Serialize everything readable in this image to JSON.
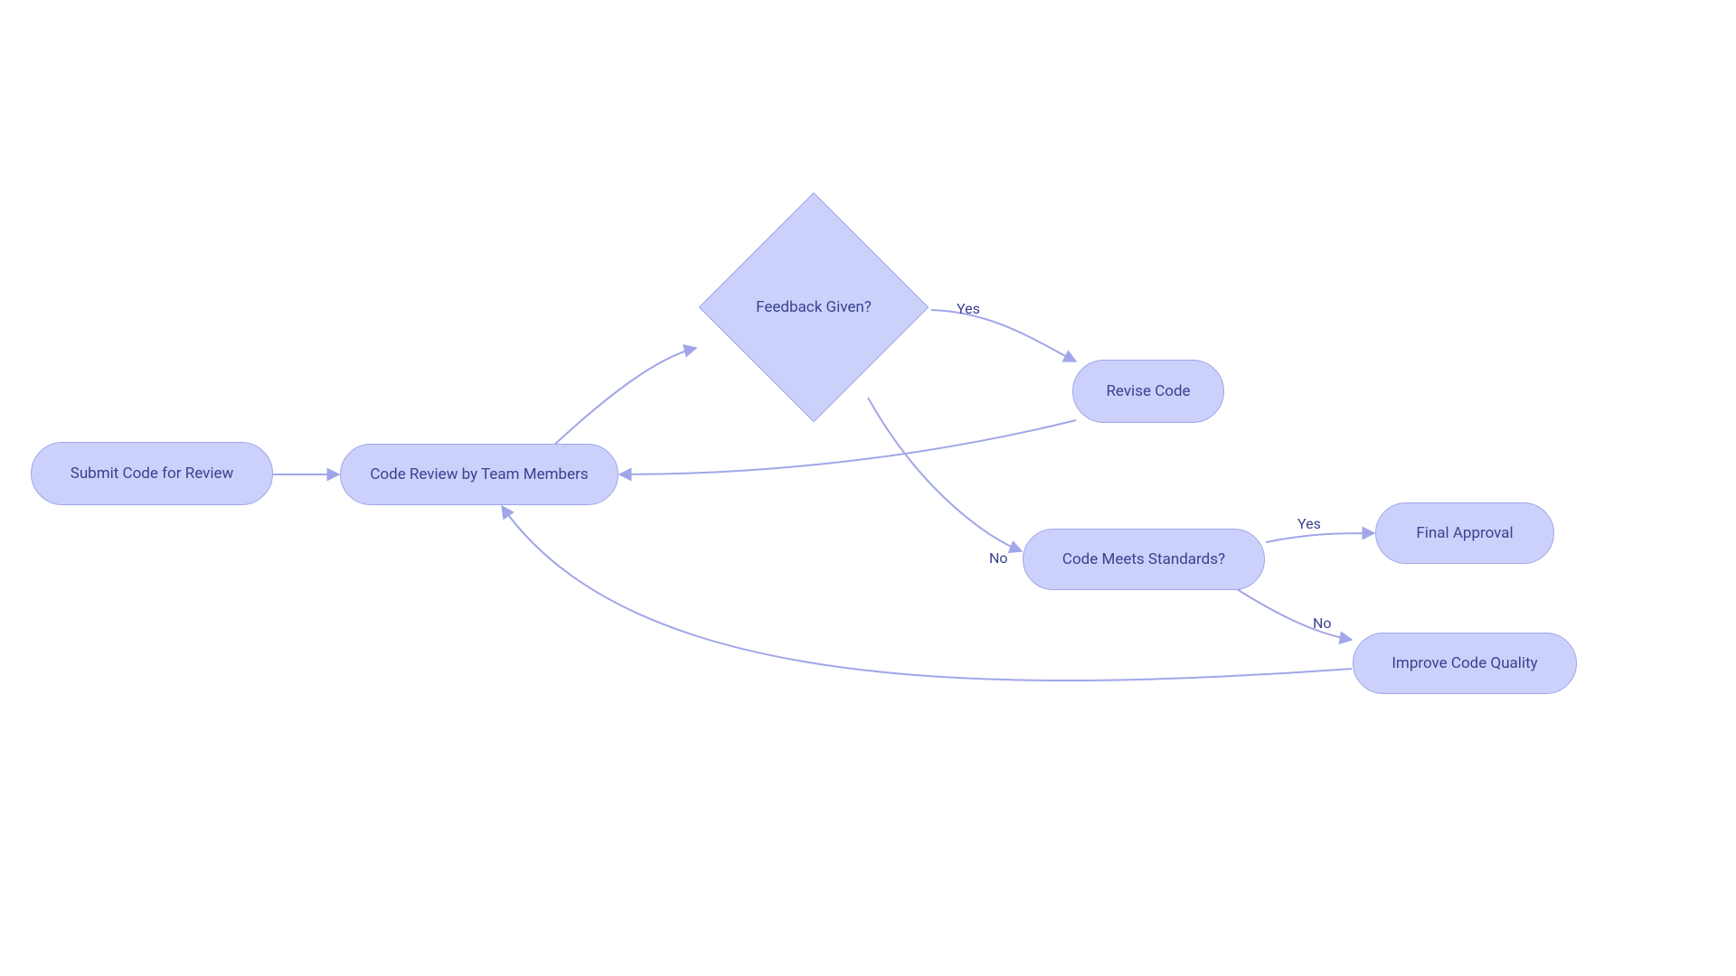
{
  "nodes": {
    "submit": {
      "label": "Submit Code for Review"
    },
    "review": {
      "label": "Code Review by Team Members"
    },
    "feedback": {
      "label": "Feedback Given?"
    },
    "revise": {
      "label": "Revise Code"
    },
    "meets": {
      "label": "Code Meets Standards?"
    },
    "final": {
      "label": "Final Approval"
    },
    "improve": {
      "label": "Improve Code Quality"
    }
  },
  "edges": {
    "feedback_yes": "Yes",
    "feedback_no": "No",
    "meets_yes": "Yes",
    "meets_no": "No"
  },
  "colors": {
    "node_fill": "#ccd1fb",
    "node_stroke": "#a0a6e8",
    "text": "#39428f"
  }
}
